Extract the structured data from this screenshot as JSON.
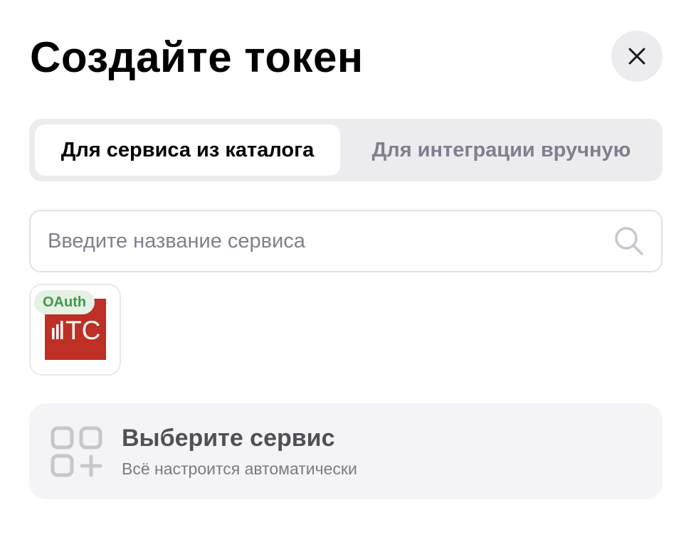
{
  "dialog": {
    "title": "Создайте токен",
    "close_icon": "close-icon"
  },
  "tabs": [
    {
      "label": "Для сервиса из каталога",
      "active": true
    },
    {
      "label": "Для интеграции вручную",
      "active": false
    }
  ],
  "search": {
    "placeholder": "Введите название сервиса",
    "value": "",
    "icon": "search-icon"
  },
  "services": [
    {
      "badge": "OAuth",
      "logo_text": "TC",
      "logo_color": "#be2f25",
      "badge_color": "#3f9a48"
    }
  ],
  "info": {
    "title": "Выберите сервис",
    "subtitle": "Всё настроится автоматически",
    "icon": "grid-add-icon"
  },
  "colors": {
    "tab_bg": "#ececef",
    "inactive_text": "#7f7f8e",
    "card_bg": "#f4f4f6"
  }
}
